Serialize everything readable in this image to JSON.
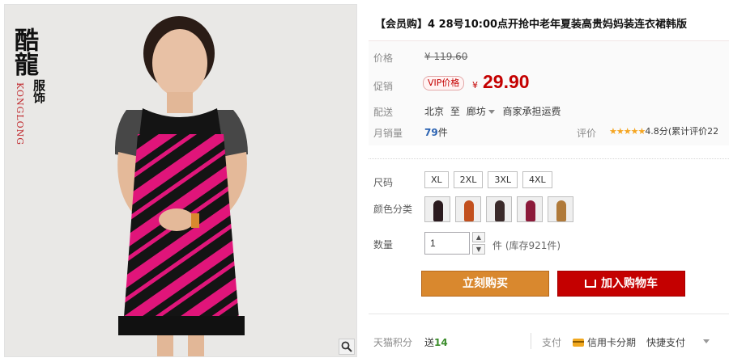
{
  "image": {
    "brand_zh": "酷龍",
    "brand_en": "KONGLONG",
    "brand_zh2": "服饰",
    "zoom_icon": "magnifier-icon"
  },
  "product": {
    "title": "【会员购】4 28号10:00点开抢中老年夏装高贵妈妈装连衣裙韩版"
  },
  "price": {
    "label": "价格",
    "original": "¥ 119.60"
  },
  "promo": {
    "label": "促销",
    "badge": "VIP价格",
    "currency": "¥",
    "price": "29.90"
  },
  "shipping": {
    "label": "配送",
    "from": "北京",
    "to_word": "至",
    "dest": "廊坊",
    "fee": "商家承担运费"
  },
  "sales": {
    "label": "月销量",
    "count": "79",
    "unit": "件"
  },
  "rating": {
    "label": "评价",
    "stars": "★★★★★",
    "score": "4.8分",
    "count_text": "(累计评价22"
  },
  "size": {
    "label": "尺码",
    "options": [
      "XL",
      "2XL",
      "3XL",
      "4XL"
    ]
  },
  "color": {
    "label": "颜色分类",
    "swatch_colors": [
      "#2a1a1e",
      "#c2501e",
      "#3a2a2a",
      "#8c1a3a",
      "#b07a3a"
    ]
  },
  "quantity": {
    "label": "数量",
    "value": "1",
    "unit": "件",
    "stock": "(库存921件)",
    "up": "▲",
    "down": "▼"
  },
  "actions": {
    "buy_now": "立刻购买",
    "add_cart": "加入购物车"
  },
  "footer": {
    "points_label": "天猫积分",
    "points_prefix": "送",
    "points_value": "14",
    "pay_label": "支付",
    "card_installment": "信用卡分期",
    "quick_pay": "快捷支付"
  },
  "colors": {
    "accent_red": "#c40000",
    "buy_orange": "#d9882e"
  }
}
